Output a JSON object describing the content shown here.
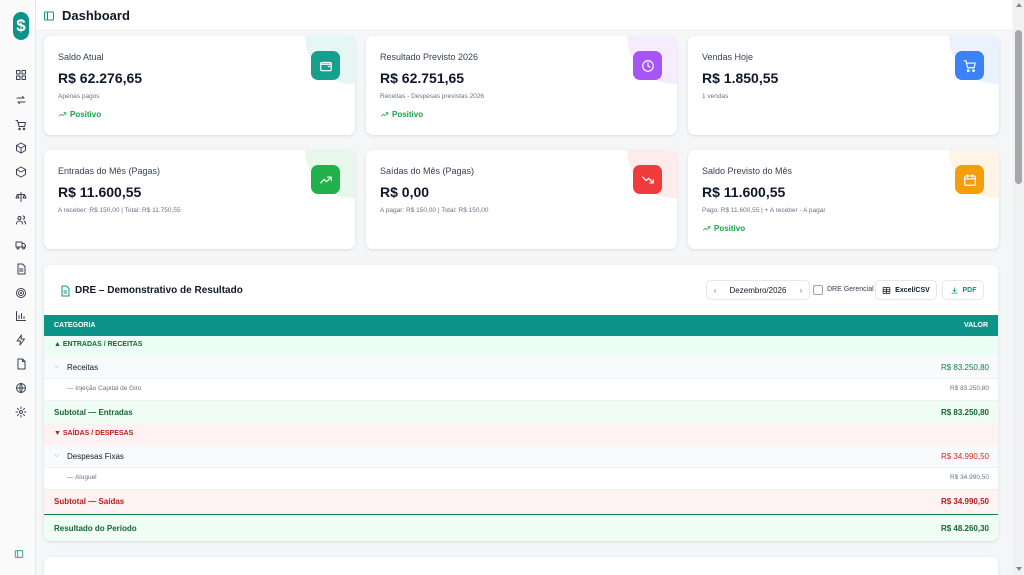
{
  "app": {
    "title": "Dashboard",
    "logo_symbol": "$"
  },
  "sidebar": {
    "items": [
      {
        "icon": "grid-icon"
      },
      {
        "icon": "arrows-icon"
      },
      {
        "icon": "cart-icon"
      },
      {
        "icon": "box-icon"
      },
      {
        "icon": "package-icon"
      },
      {
        "icon": "scale-icon"
      },
      {
        "icon": "users-icon"
      },
      {
        "icon": "truck-icon"
      },
      {
        "icon": "file-icon"
      },
      {
        "icon": "target-icon"
      },
      {
        "icon": "bar-chart-icon"
      },
      {
        "icon": "zap-icon"
      },
      {
        "icon": "document-icon"
      },
      {
        "icon": "globe-icon"
      },
      {
        "icon": "gear-icon"
      }
    ]
  },
  "cards": [
    {
      "label": "Saldo Atual",
      "value": "R$ 62.276,65",
      "sub": "Apenas pagos",
      "trend": "Positivo",
      "icon": "wallet-icon",
      "color": "#14a08c",
      "tint": "#e6f6f3"
    },
    {
      "label": "Resultado Previsto 2026",
      "value": "R$ 62.751,65",
      "sub": "Receitas - Despesas previstas 2026",
      "trend": "Positivo",
      "icon": "clock-icon",
      "color": "#a855f7",
      "tint": "#f5edfe"
    },
    {
      "label": "Vendas Hoje",
      "value": "R$ 1.850,55",
      "sub": "1 vendas",
      "trend": "",
      "icon": "cart-icon",
      "color": "#3b82f6",
      "tint": "#eaf2fe"
    },
    {
      "label": "Entradas do Mês (Pagas)",
      "value": "R$ 11.600,55",
      "sub": "A receber: R$ 150,00 | Total: R$ 11.750,55",
      "trend": "",
      "icon": "trend-up-icon",
      "color": "#22b04b",
      "tint": "#e8f7ec"
    },
    {
      "label": "Saídas do Mês (Pagas)",
      "value": "R$ 0,00",
      "sub": "A pagar: R$ 150,00 | Total: R$ 150,00",
      "trend": "",
      "icon": "trend-down-icon",
      "color": "#ef3b3b",
      "tint": "#fdecec"
    },
    {
      "label": "Saldo Previsto do Mês",
      "value": "R$ 11.600,55",
      "sub": "Pago: R$ 11.600,55 | + A receber - A pagar",
      "trend": "Positivo",
      "icon": "calendar-icon",
      "color": "#f59e0b",
      "tint": "#fef5e6"
    }
  ],
  "dre": {
    "title": "DRE – Demonstrativo de Resultado",
    "month": "Dezembro/2026",
    "prev": "‹",
    "next": "›",
    "gerencial_label": "DRE Gerencial",
    "excel_label": "Excel/CSV",
    "pdf_label": "PDF",
    "col_category": "CATEGORIA",
    "col_value": "VALOR",
    "rows": [
      {
        "kind": "section-in",
        "label": "▲ ENTRADAS / RECEITAS",
        "value": ""
      },
      {
        "kind": "group",
        "label": "Receitas",
        "value": "R$ 83.250,80",
        "color": "#15803d"
      },
      {
        "kind": "leaf",
        "label": "— Injeção Capital de Giro",
        "value": "R$ 83.250,80"
      },
      {
        "kind": "subtotal-in",
        "label": "Subtotal — Entradas",
        "value": "R$ 83.250,80"
      },
      {
        "kind": "section-out",
        "label": "▼ SAÍDAS / DESPESAS",
        "value": ""
      },
      {
        "kind": "group",
        "label": "Despesas Fixas",
        "value": "R$ 34.990,50",
        "color": "#dc2626"
      },
      {
        "kind": "leaf",
        "label": "— Aluguel",
        "value": "R$ 34.990,50"
      },
      {
        "kind": "subtotal-out",
        "label": "Subtotal — Saídas",
        "value": "R$ 34.990,50"
      },
      {
        "kind": "result",
        "label": "Resultado do Período",
        "value": "R$ 48.260,30"
      }
    ]
  }
}
